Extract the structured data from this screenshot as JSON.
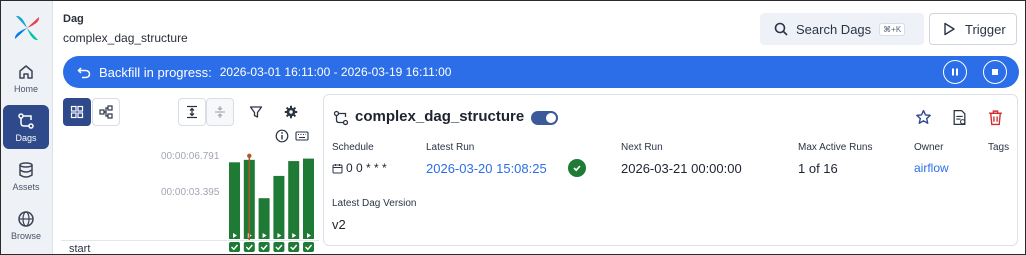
{
  "sidebar": {
    "items": [
      {
        "label": "Home",
        "icon": "home-icon",
        "active": false
      },
      {
        "label": "Dags",
        "icon": "dags-icon",
        "active": true
      },
      {
        "label": "Assets",
        "icon": "database-icon",
        "active": false
      },
      {
        "label": "Browse",
        "icon": "globe-icon",
        "active": false
      }
    ]
  },
  "header": {
    "label": "Dag",
    "dag_id": "complex_dag_structure",
    "search_label": "Search Dags",
    "search_shortcut": "⌘+K",
    "trigger_label": "Trigger"
  },
  "banner": {
    "label": "Backfill in progress:",
    "range": "2026-03-01 16:11:00 - 2026-03-19 16:11:00",
    "color": "#2c6ee8"
  },
  "grid": {
    "y_labels": [
      "00:00:06.791",
      "00:00:03.395"
    ],
    "row_label": "start",
    "chart_data": {
      "type": "bar",
      "unit": "seconds",
      "y_max": 6.791,
      "y_mid": 3.395,
      "values": [
        6.2,
        6.4,
        3.3,
        5.1,
        6.3,
        6.5
      ],
      "current_run_index": 1,
      "bar_color": "#1f7a36",
      "marker_color": "#b5552b",
      "task_states": [
        "success",
        "success",
        "success",
        "success",
        "success",
        "success"
      ]
    }
  },
  "details": {
    "title": "complex_dag_structure",
    "schedule_label": "Schedule",
    "schedule_value": "0 0 * * *",
    "latest_run_label": "Latest Run",
    "latest_run_value": "2026-03-20 15:08:25",
    "next_run_label": "Next Run",
    "next_run_value": "2026-03-21 00:00:00",
    "max_active_label": "Max Active Runs",
    "max_active_value": "1 of 16",
    "owner_label": "Owner",
    "owner_value": "airflow",
    "tags_label": "Tags",
    "version_label": "Latest Dag Version",
    "version_value": "v2"
  },
  "colors": {
    "accent": "#2c6ee8",
    "success": "#1f7a36",
    "delete": "#d32f2f",
    "nav_active": "#2f4a8a"
  }
}
